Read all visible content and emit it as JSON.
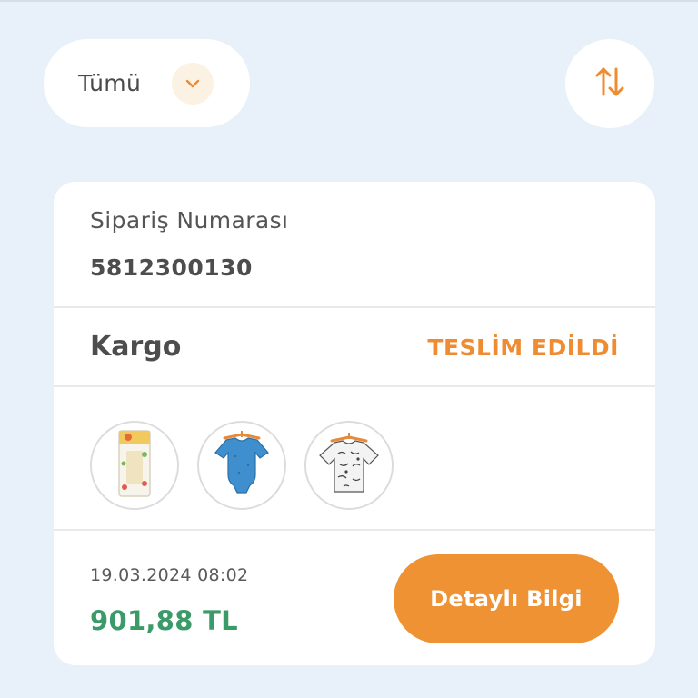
{
  "filter": {
    "label": "Tümü",
    "icon": "chevron-down-icon"
  },
  "sort": {
    "icon": "sort-arrows-icon"
  },
  "order": {
    "number_label": "Sipariş Numarası",
    "number": "5812300130",
    "shipping_label": "Kargo",
    "status": "TESLİM EDİLDİ",
    "products": [
      {
        "name": "product-box-icon"
      },
      {
        "name": "blue-bodysuit-icon"
      },
      {
        "name": "patterned-tshirt-icon"
      }
    ],
    "date": "19.03.2024 08:02",
    "price": "901,88 TL",
    "details_button": "Detaylı Bilgi"
  },
  "colors": {
    "accent": "#ef9233",
    "status": "#ef8b30",
    "price": "#3a9a68",
    "background": "#e8f1f9"
  }
}
